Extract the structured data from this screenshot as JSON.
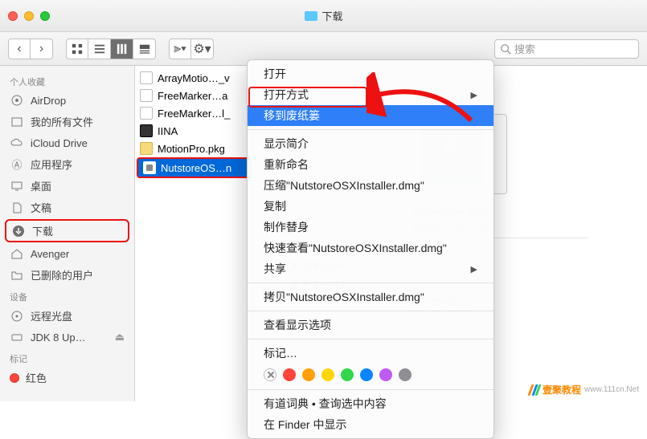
{
  "window": {
    "title": "下载"
  },
  "toolbar": {
    "search_placeholder": "搜索"
  },
  "sidebar": {
    "favorites_header": "个人收藏",
    "items": [
      {
        "label": "AirDrop"
      },
      {
        "label": "我的所有文件"
      },
      {
        "label": "iCloud Drive"
      },
      {
        "label": "应用程序"
      },
      {
        "label": "桌面"
      },
      {
        "label": "文稿"
      },
      {
        "label": "下载"
      },
      {
        "label": "Avenger"
      },
      {
        "label": "已删除的用户"
      }
    ],
    "devices_header": "设备",
    "devices": [
      {
        "label": "远程光盘"
      },
      {
        "label": "JDK 8 Up…"
      }
    ],
    "tags_header": "标记",
    "tags": [
      {
        "label": "红色"
      }
    ]
  },
  "file_list": [
    {
      "name": "ArrayMotio…_v",
      "type": "doc"
    },
    {
      "name": "FreeMarker…a",
      "type": "doc"
    },
    {
      "name": "FreeMarker…l_",
      "type": "doc"
    },
    {
      "name": "IINA",
      "type": "app"
    },
    {
      "name": "MotionPro.pkg",
      "type": "pkg"
    },
    {
      "name": "NutstoreOS…n",
      "type": "dmg",
      "selected": true
    }
  ],
  "context_menu": {
    "open": "打开",
    "open_with": "打开方式",
    "move_to_trash": "移到废纸篓",
    "get_info": "显示简介",
    "rename": "重新命名",
    "compress": "压缩\"NutstoreOSXInstaller.dmg\"",
    "duplicate": "复制",
    "make_alias": "制作替身",
    "quick_look": "快速查看\"NutstoreOSXInstaller.dmg\"",
    "share": "共享",
    "copy": "拷贝\"NutstoreOSXInstaller.dmg\"",
    "view_options": "查看显示选项",
    "tags_label": "标记…",
    "colors": [
      "#ff453a",
      "#ff9f0a",
      "#ffd60a",
      "#32d74b",
      "#0a84ff",
      "#bf5af2",
      "#8e8e93"
    ],
    "dictionary": "有道词典 • 查询选中内容",
    "show_in_finder": "在 Finder 中显示"
  },
  "preview": {
    "filename": "SXInstaller.dmg",
    "kind": "盘映像 — 43.5 MB",
    "times": [
      "天 下午10:34",
      "天 下午10:34",
      "天 下午10:34"
    ],
    "add_tags": "加标记…"
  },
  "watermark": {
    "brand": "壹聚教程",
    "url": "www.111cn.Net"
  }
}
